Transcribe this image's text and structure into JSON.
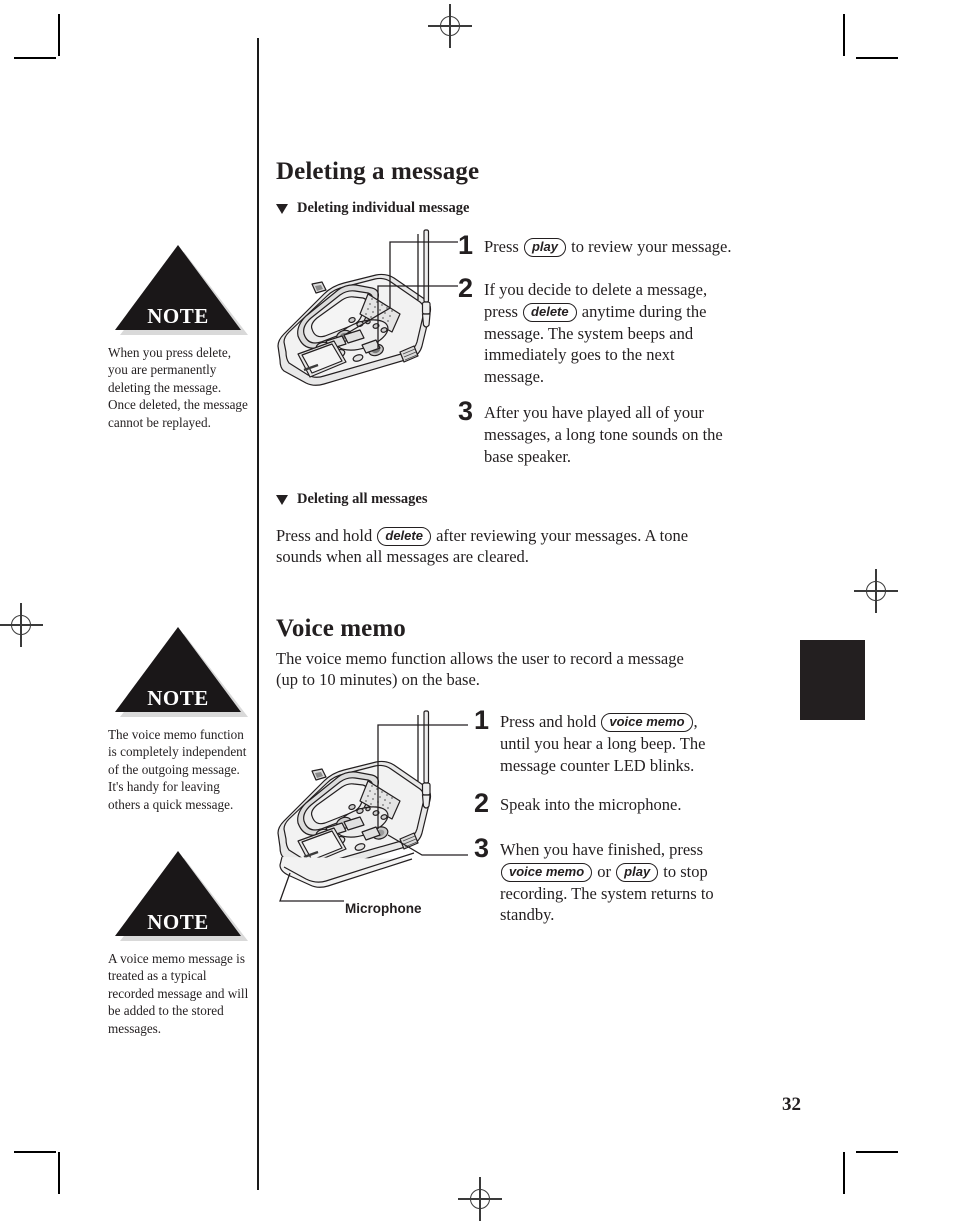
{
  "page": {
    "number": "32"
  },
  "notes": [
    {
      "badge": "NOTE",
      "lines": [
        "When you press delete,",
        "you are permanently",
        "deleting the message.",
        "Once deleted, the message",
        "cannot be replayed."
      ]
    },
    {
      "badge": "NOTE",
      "lines": [
        "The voice memo function",
        "is completely  independent",
        "of the outgoing message.",
        "It's handy for leaving",
        "others a quick message."
      ]
    },
    {
      "badge": "NOTE",
      "lines": [
        "A voice memo message is",
        "treated as a typical",
        "recorded message and will",
        "be added to the stored",
        "messages."
      ]
    }
  ],
  "sections": {
    "deleting": {
      "title": "Deleting a message",
      "sub_individual": "Deleting individual message",
      "sub_all": "Deleting all messages",
      "all_lines": [
        [
          "Press and hold ",
          "delete",
          " after reviewing your messages. A tone"
        ],
        [
          "sounds when all messages are cleared."
        ]
      ],
      "steps": [
        {
          "num": "1",
          "lines": [
            [
              "Press ",
              "play",
              " to review your message."
            ]
          ]
        },
        {
          "num": "2",
          "lines": [
            [
              "If you decide to delete a message,"
            ],
            [
              "press ",
              "delete",
              " anytime during the"
            ],
            [
              "message. The system beeps and"
            ],
            [
              "immediately goes to the next"
            ],
            [
              "message."
            ]
          ]
        },
        {
          "num": "3",
          "lines": [
            [
              "After you have played all of your"
            ],
            [
              "messages, a long tone sounds on the"
            ],
            [
              "base speaker."
            ]
          ]
        }
      ]
    },
    "voice_memo": {
      "title": "Voice memo",
      "intro_lines": [
        "The voice memo function allows the user to record a message",
        "(up to 10 minutes) on the base."
      ],
      "callout": "Microphone",
      "steps": [
        {
          "num": "1",
          "lines": [
            [
              "Press and hold ",
              "voice memo",
              ","
            ],
            [
              "until you hear a long beep. The"
            ],
            [
              "message counter LED blinks."
            ]
          ]
        },
        {
          "num": "2",
          "lines": [
            [
              "Speak into the microphone."
            ]
          ]
        },
        {
          "num": "3",
          "lines": [
            [
              "When you have finished, press"
            ],
            [
              "",
              "voice memo",
              " or ",
              "play",
              " to stop"
            ],
            [
              "recording. The system returns to"
            ],
            [
              "standby."
            ]
          ]
        }
      ]
    }
  },
  "colors": {
    "ink": "#231f20",
    "note_fill": "#1a1718",
    "rule": "#1a1a1a"
  }
}
